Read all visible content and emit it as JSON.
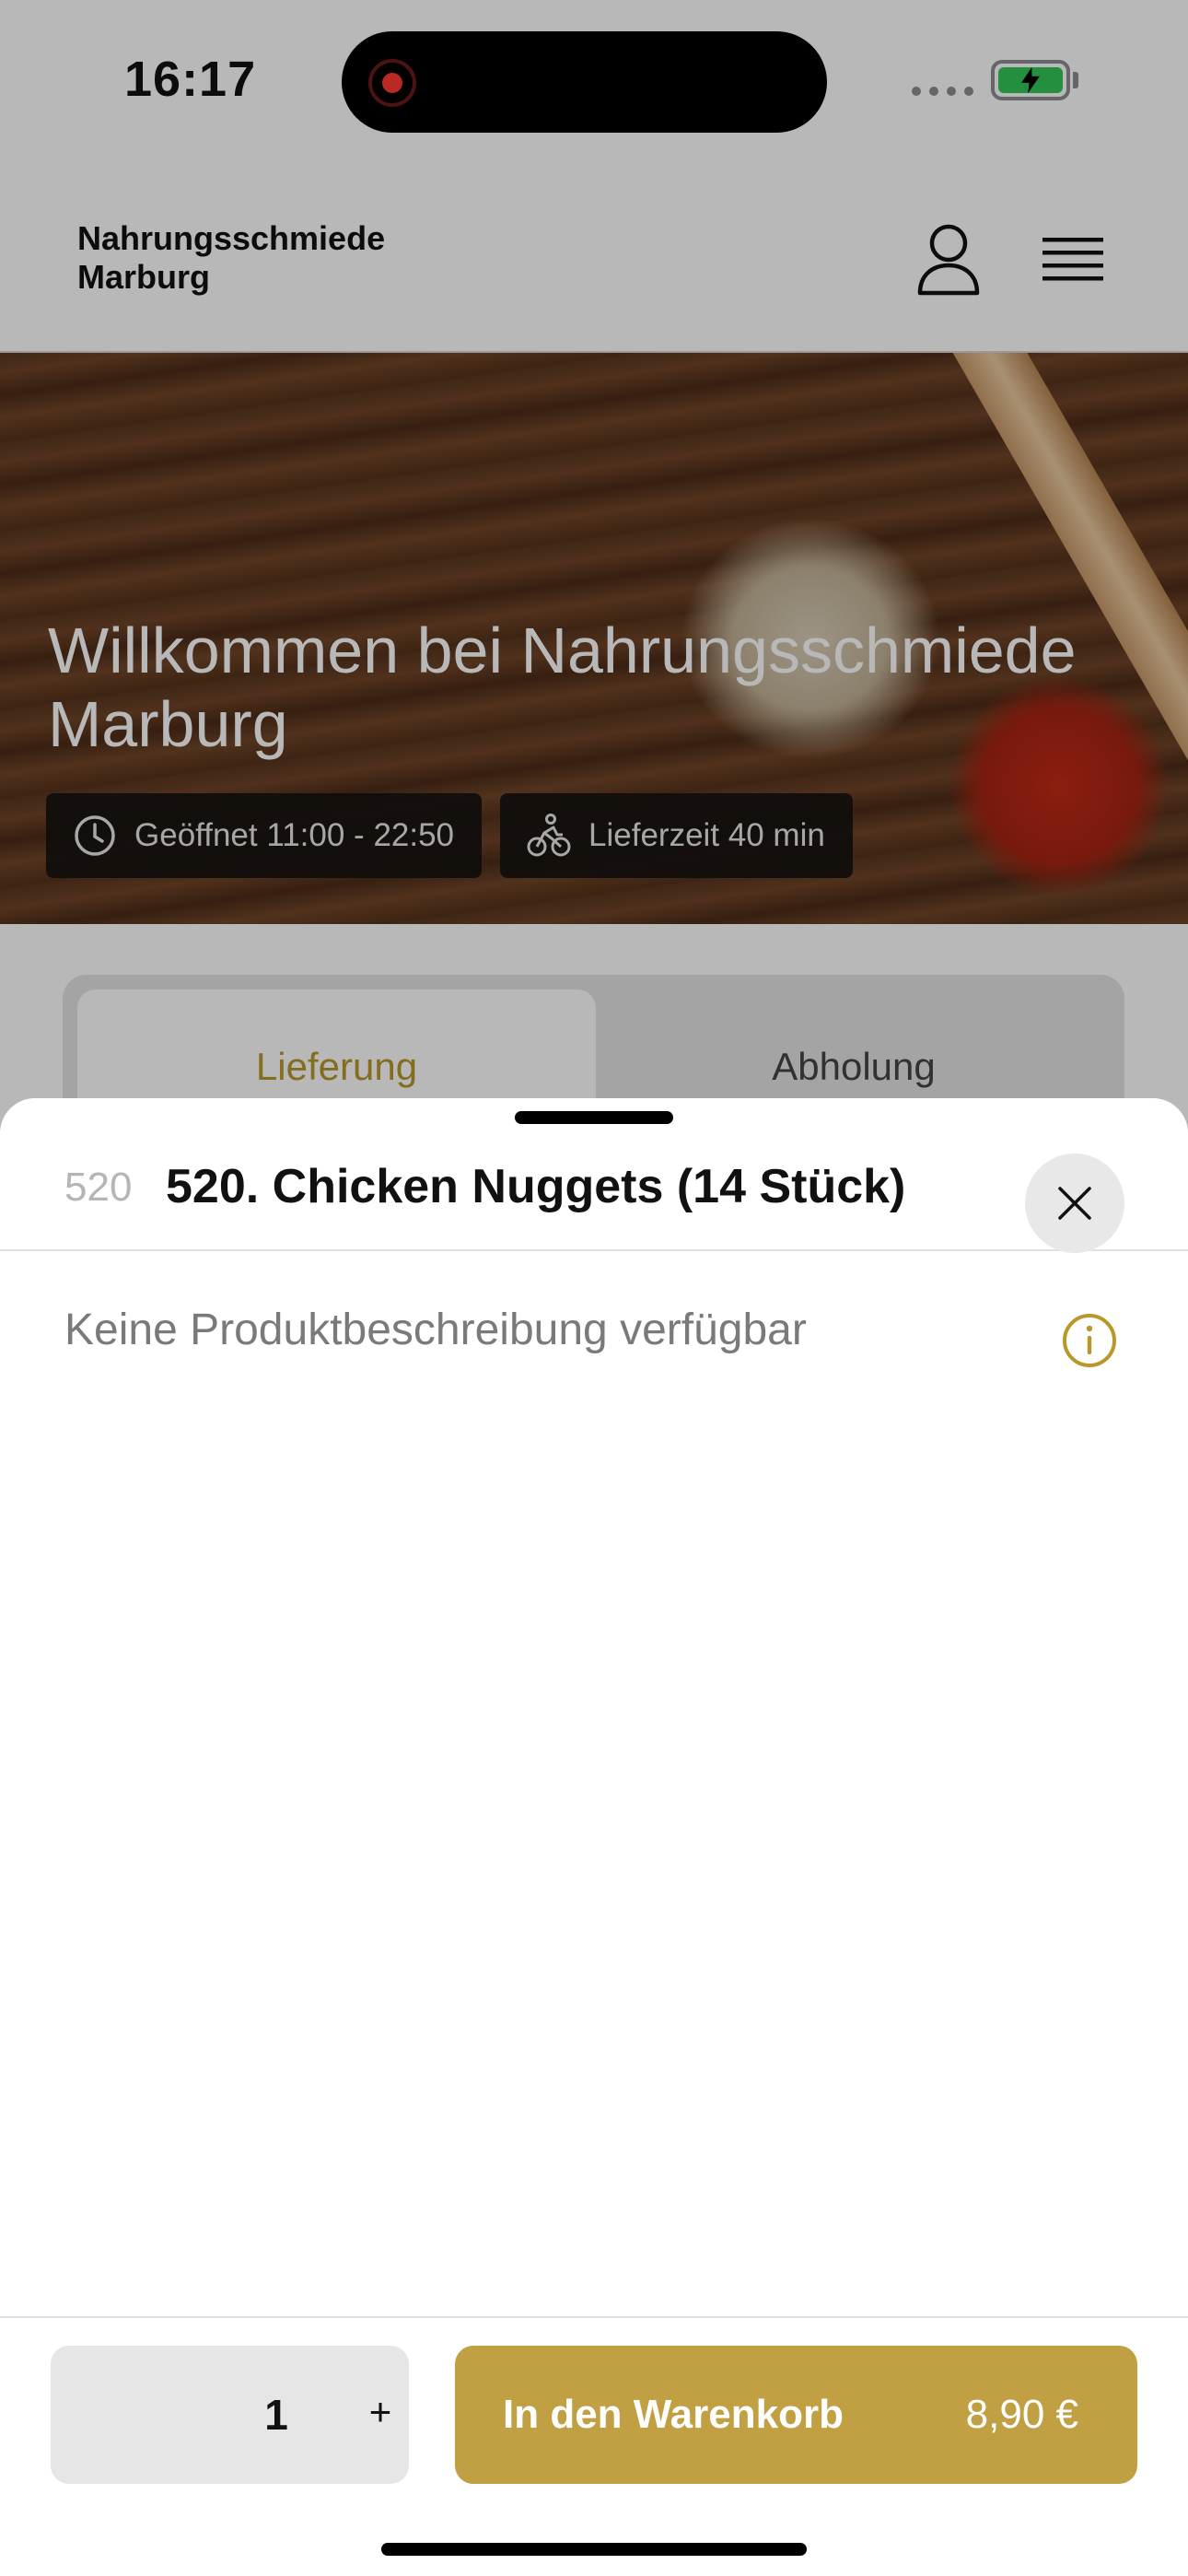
{
  "status_bar": {
    "time": "16:17"
  },
  "header": {
    "brand_name": "Nahrungsschmiede Marburg",
    "icons": [
      "user-icon",
      "menu-icon"
    ]
  },
  "hero": {
    "title": "Willkommen bei Nahrungsschmiede Marburg",
    "badges": [
      {
        "icon": "clock-icon",
        "label": "Geöffnet 11:00 - 22:50"
      },
      {
        "icon": "bike-icon",
        "label": "Lieferzeit 40 min"
      }
    ]
  },
  "order_tabs": {
    "items": [
      {
        "label": "Lieferung",
        "selected": true
      },
      {
        "label": "Abholung",
        "selected": false
      }
    ]
  },
  "product_sheet": {
    "number": "520",
    "title": "520. Chicken Nuggets (14 Stück)",
    "description": "Keine Produktbeschreibung verfügbar",
    "quantity": "1",
    "plus_label": "+",
    "add_to_cart_label": "In den Warenkorb",
    "price": "8,90 €"
  },
  "colors": {
    "accent": "#c0a043",
    "accent_text": "#b9972b",
    "battery": "#34c759",
    "record": "#ff3b30"
  }
}
